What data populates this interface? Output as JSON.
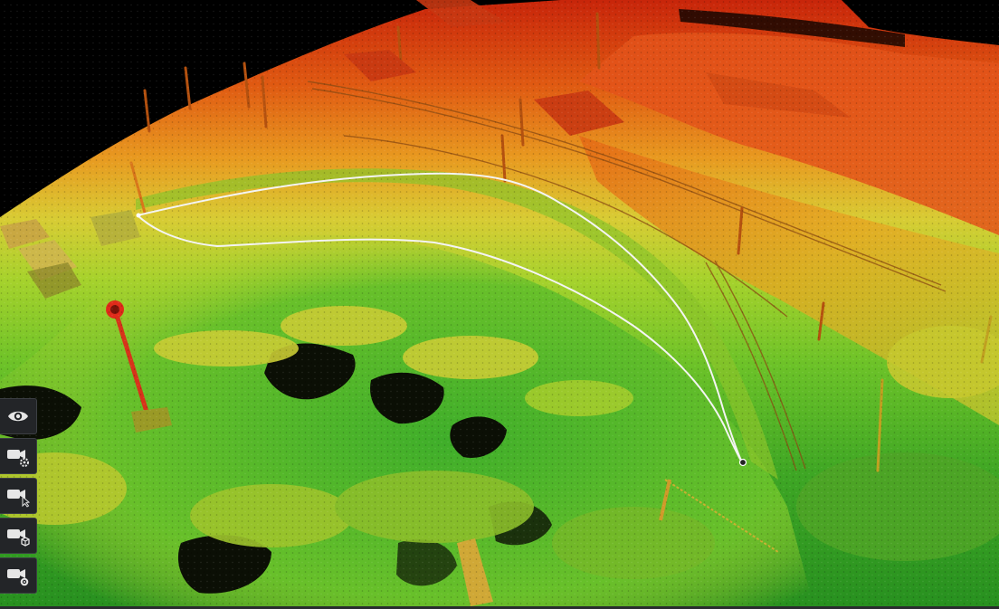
{
  "viewer": {
    "view": "3D point cloud",
    "color_mode": "elevation",
    "color_ramp": [
      "#1f8f22",
      "#7cc426",
      "#d8d430",
      "#ee8a1c",
      "#d6300e"
    ],
    "background_color": "#000000",
    "path_color": "#ffffff"
  },
  "toolbar": {
    "buttons": [
      {
        "icon": "eye-icon",
        "name": "visibility-button"
      },
      {
        "icon": "camera-settings-icon",
        "name": "camera-settings-button"
      },
      {
        "icon": "camera-pointer-icon",
        "name": "camera-pointer-button"
      },
      {
        "icon": "camera-box-icon",
        "name": "camera-box-button"
      },
      {
        "icon": "camera-target-icon",
        "name": "camera-target-button"
      }
    ]
  }
}
